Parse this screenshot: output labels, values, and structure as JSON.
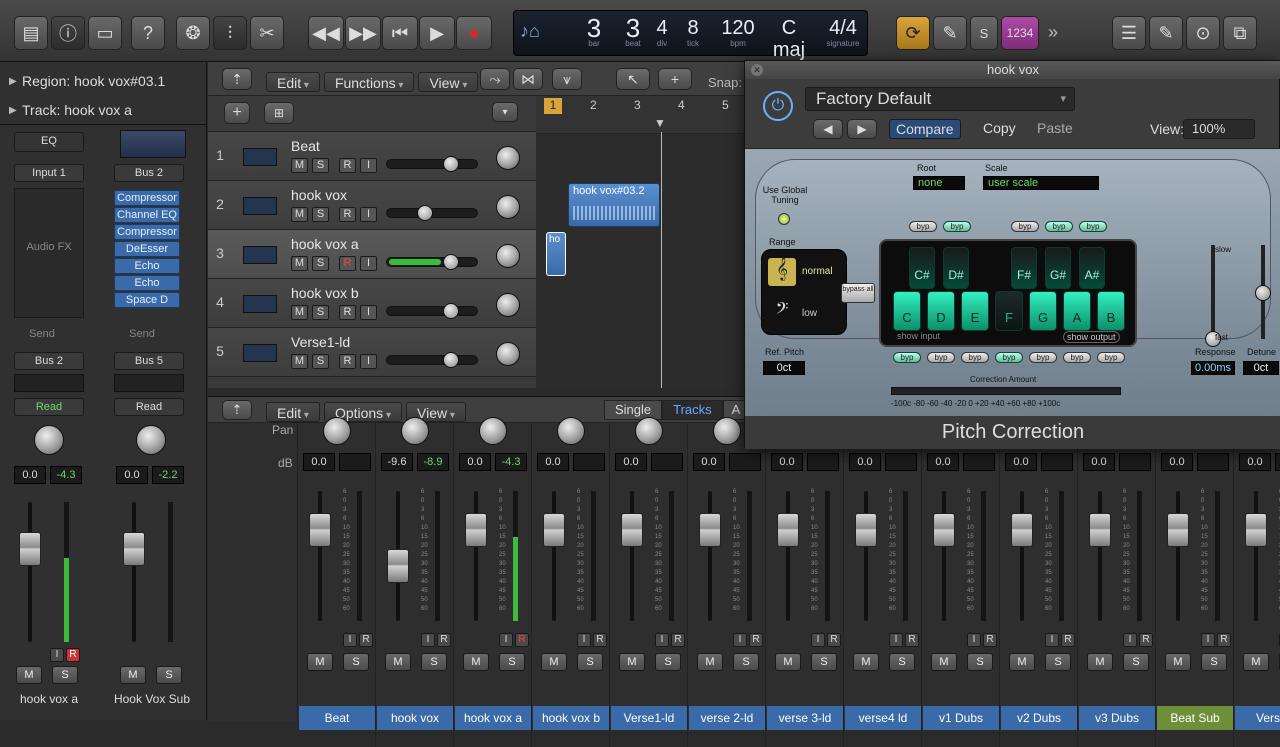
{
  "toolbar": {
    "lcd": {
      "bar": "3",
      "beat": "3",
      "div": "4",
      "tick": "8",
      "bpm": "120",
      "key": "C maj",
      "signature": "4/4",
      "labels": {
        "bar": "bar",
        "beat": "beat",
        "div": "div",
        "tick": "tick",
        "bpm": "bpm",
        "key": "key",
        "signature": "signature"
      }
    },
    "solo_label": "S",
    "count_in": "1234"
  },
  "inspector": {
    "region_label": "Region: hook vox#03.1",
    "track_label": "Track:  hook vox a",
    "left_strip": {
      "eq": "EQ",
      "input": "Input 1",
      "audio_fx": "Audio FX",
      "send": "Send",
      "output": "Bus 2",
      "automation": "Read",
      "vol": "0.0",
      "peak": "-4.3",
      "name": "hook vox a"
    },
    "right_strip": {
      "input": "Bus 2",
      "plugins": [
        "Compressor",
        "Channel EQ",
        "Compressor",
        "DeEsser",
        "Echo",
        "Echo",
        "Space D"
      ],
      "send": "Send",
      "output": "Bus 5",
      "automation": "Read",
      "vol": "0.0",
      "peak": "-2.2",
      "name": "Hook Vox Sub"
    }
  },
  "tracks_header": {
    "menus": [
      "Edit",
      "Functions",
      "View"
    ],
    "snap": "Snap:",
    "ruler": [
      "1",
      "2",
      "3",
      "4",
      "5"
    ]
  },
  "tracks": [
    {
      "num": "1",
      "name": "Beat"
    },
    {
      "num": "2",
      "name": "hook vox"
    },
    {
      "num": "3",
      "name": "hook vox a"
    },
    {
      "num": "4",
      "name": "hook vox b"
    },
    {
      "num": "5",
      "name": "Verse1-ld"
    }
  ],
  "track_buttons": {
    "mute": "M",
    "solo": "S",
    "record": "R",
    "input": "I"
  },
  "regions": {
    "r1": "hook vox#03.2",
    "r2": "ho"
  },
  "mixer": {
    "menus": [
      "Edit",
      "Options",
      "View"
    ],
    "view_tabs": [
      "Single",
      "Tracks",
      "A"
    ],
    "row_labels": {
      "pan": "Pan",
      "db": "dB"
    },
    "strips": [
      {
        "name": "Beat",
        "vol": "0.0",
        "peak": ""
      },
      {
        "name": "hook vox",
        "vol": "-9.6",
        "peak": "-8.9"
      },
      {
        "name": "hook vox a",
        "vol": "0.0",
        "peak": "-4.3"
      },
      {
        "name": "hook vox b",
        "vol": "0.0",
        "peak": ""
      },
      {
        "name": "Verse1-ld",
        "vol": "0.0",
        "peak": ""
      },
      {
        "name": "verse 2-ld",
        "vol": "0.0",
        "peak": ""
      },
      {
        "name": "verse 3-ld",
        "vol": "0.0",
        "peak": ""
      },
      {
        "name": "verse4 ld",
        "vol": "0.0",
        "peak": ""
      },
      {
        "name": "v1 Dubs",
        "vol": "0.0",
        "peak": ""
      },
      {
        "name": "v2 Dubs",
        "vol": "0.0",
        "peak": ""
      },
      {
        "name": "v3 Dubs",
        "vol": "0.0",
        "peak": ""
      },
      {
        "name": "Beat Sub",
        "vol": "0.0",
        "peak": ""
      },
      {
        "name": "Verse.",
        "vol": "0.0",
        "peak": ""
      }
    ],
    "fader_scale": [
      "6",
      "0",
      "3",
      "6",
      "10",
      "15",
      "20",
      "25",
      "30",
      "35",
      "40",
      "45",
      "50",
      "60"
    ]
  },
  "plugin": {
    "window_title": "hook vox",
    "preset": "Factory Default",
    "compare": "Compare",
    "copy": "Copy",
    "paste": "Paste",
    "view_label": "View:",
    "view_value": "100%",
    "root_label": "Root",
    "root_value": "none",
    "scale_label": "Scale",
    "scale_value": "user scale",
    "use_global_tuning": "Use Global Tuning",
    "range_label": "Range",
    "range_normal": "normal",
    "range_low": "low",
    "bypass_all": "bypass all",
    "ref_pitch_label": "Ref. Pitch",
    "ref_pitch_value": "0ct",
    "keys_white": [
      "C",
      "D",
      "E",
      "F",
      "G",
      "A",
      "B"
    ],
    "keys_black": [
      "C#",
      "D#",
      "F#",
      "G#",
      "A#"
    ],
    "byp": "byp",
    "show_input": "show input",
    "show_output": "show output",
    "correction_amount": "Correction Amount",
    "correction_scale": "-100c -80 -60 -40 -20 0 +20 +40 +60 +80 +100c",
    "slow": "slow",
    "fast": "fast",
    "response_label": "Response",
    "response_value": "0.00ms",
    "detune_label": "Detune",
    "detune_value": "0ct",
    "plugin_name": "Pitch Correction"
  }
}
